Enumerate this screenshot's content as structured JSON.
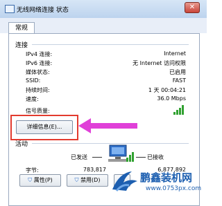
{
  "window": {
    "title": "无线网络连接 状态",
    "close_label": "✕"
  },
  "tabs": [
    {
      "label": "常规"
    }
  ],
  "connection": {
    "section_label": "连接",
    "rows": [
      {
        "label": "IPv4 连接:",
        "value": "Internet"
      },
      {
        "label": "IPv6 连接:",
        "value": "无 Internet 访问权限"
      },
      {
        "label": "媒体状态:",
        "value": "已启用"
      },
      {
        "label": "SSID:",
        "value": "FAST"
      },
      {
        "label": "持续时间:",
        "value": "1 天 00:04:21"
      },
      {
        "label": "速度:",
        "value": "36.0 Mbps"
      }
    ],
    "signal_label": "信号质量:",
    "details_button": "详细信息(E)..."
  },
  "activity": {
    "section_label": "活动",
    "sent_label": "已发送",
    "received_label": "已接收",
    "bytes_label": "字节:",
    "sent_value": "783,817",
    "received_value": "6,877,892"
  },
  "buttons": {
    "properties": "属性(P)",
    "disable": "禁用(D)",
    "diagnose": "诊"
  },
  "watermark": {
    "name": "鹏鑫装机网",
    "url": "www.0753px.com"
  },
  "colors": {
    "highlight": "#e33a2e",
    "arrow": "#e040d8",
    "signal": "#31a131"
  }
}
